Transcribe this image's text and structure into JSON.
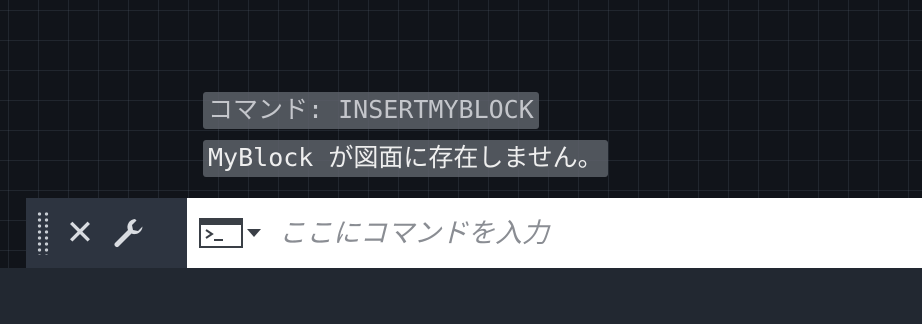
{
  "history": {
    "line1": "コマンド: INSERTMYBLOCK",
    "line2": "MyBlock が図面に存在しません。"
  },
  "command_bar": {
    "close_icon": "close-icon",
    "settings_icon": "wrench-icon",
    "prompt_icon": "command-prompt-icon",
    "input_value": "",
    "input_placeholder": "ここにコマンドを入力"
  },
  "colors": {
    "canvas_background": "#11141a",
    "command_bar_background": "#2d3440",
    "history_highlight": "#5c6068"
  }
}
